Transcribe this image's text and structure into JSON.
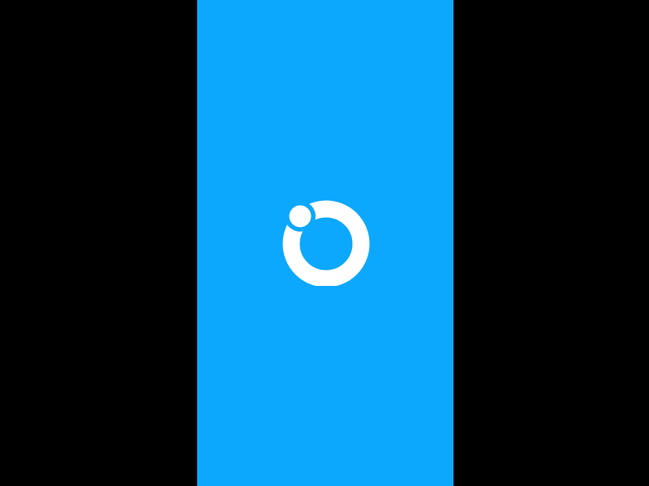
{
  "screen": {
    "type": "splash-screen",
    "background_color": "#0ca8fd",
    "letterbox_color": "#000000"
  },
  "logo": {
    "icon": "ring-with-dot-logo-icon",
    "color": "#ffffff"
  }
}
